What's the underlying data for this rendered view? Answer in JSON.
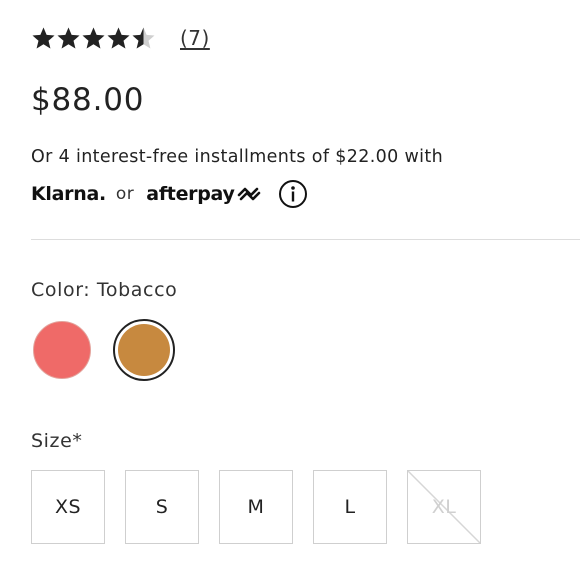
{
  "rating": {
    "stars": [
      1,
      1,
      1,
      1,
      0.5
    ],
    "star_color": "#222222",
    "empty_star_color": "#cfcfcf",
    "count_label": "(7)"
  },
  "price": "$88.00",
  "installments": {
    "text": "Or 4 interest-free installments of $22.00 with",
    "klarna_label": "Klarna.",
    "or_label": "or",
    "afterpay_label": "afterpay",
    "afterpay_icon": "afterpay-arrows-icon",
    "info_icon": "info-circle-icon"
  },
  "color": {
    "label": "Color: Tobacco",
    "swatches": [
      {
        "name": "coral",
        "hex": "#ef6a68",
        "selected": false
      },
      {
        "name": "tobacco",
        "hex": "#c7893f",
        "selected": true
      }
    ]
  },
  "size": {
    "label": "Size*",
    "options": [
      {
        "label": "XS",
        "available": true
      },
      {
        "label": "S",
        "available": true
      },
      {
        "label": "M",
        "available": true
      },
      {
        "label": "L",
        "available": true
      },
      {
        "label": "XL",
        "available": false
      }
    ]
  }
}
